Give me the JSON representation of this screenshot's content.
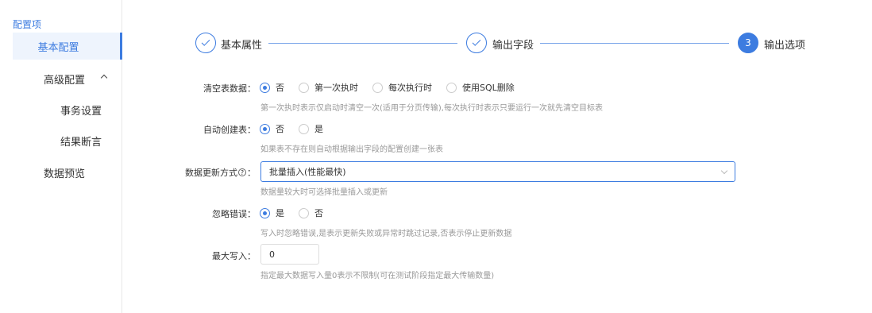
{
  "sidebar": {
    "title": "配置项",
    "items": [
      {
        "label": "基本配置"
      },
      {
        "label": "高级配置"
      },
      {
        "label": "事务设置"
      },
      {
        "label": "结果断言"
      },
      {
        "label": "数据预览"
      }
    ]
  },
  "steps": [
    {
      "label": "基本属性",
      "state": "done",
      "icon": "check-icon"
    },
    {
      "label": "输出字段",
      "state": "done",
      "icon": "check-icon"
    },
    {
      "label": "输出选项",
      "state": "active",
      "number": "3"
    }
  ],
  "form": {
    "truncate": {
      "label": "清空表数据：",
      "options": [
        "否",
        "第一次执时",
        "每次执行时",
        "使用SQL删除"
      ],
      "selected": "否",
      "hint": "第一次执时表示仅启动时清空一次(适用于分页传输),每次执行时表示只要运行一次就先清空目标表"
    },
    "auto_create": {
      "label": "自动创建表：",
      "options": [
        "否",
        "是"
      ],
      "selected": "否",
      "hint": "如果表不存在则自动根据输出字段的配置创建一张表"
    },
    "update_mode": {
      "label_pre": "数据更新方式",
      "help": "?",
      "label_post": "：",
      "value": "批量插入(性能最快)",
      "hint": "数据量较大时可选择批量插入或更新"
    },
    "ignore_error": {
      "label": "忽略错误：",
      "options": [
        "是",
        "否"
      ],
      "selected": "是",
      "hint": "写入时忽略错误,是表示更新失败或异常时跳过记录,否表示停止更新数据"
    },
    "max_write": {
      "label": "最大写入：",
      "value": "0",
      "hint": "指定最大数据写入量0表示不限制(可在测试阶段指定最大传输数量)"
    }
  },
  "colors": {
    "accent": "#3d7ce0",
    "hint": "#999999"
  }
}
